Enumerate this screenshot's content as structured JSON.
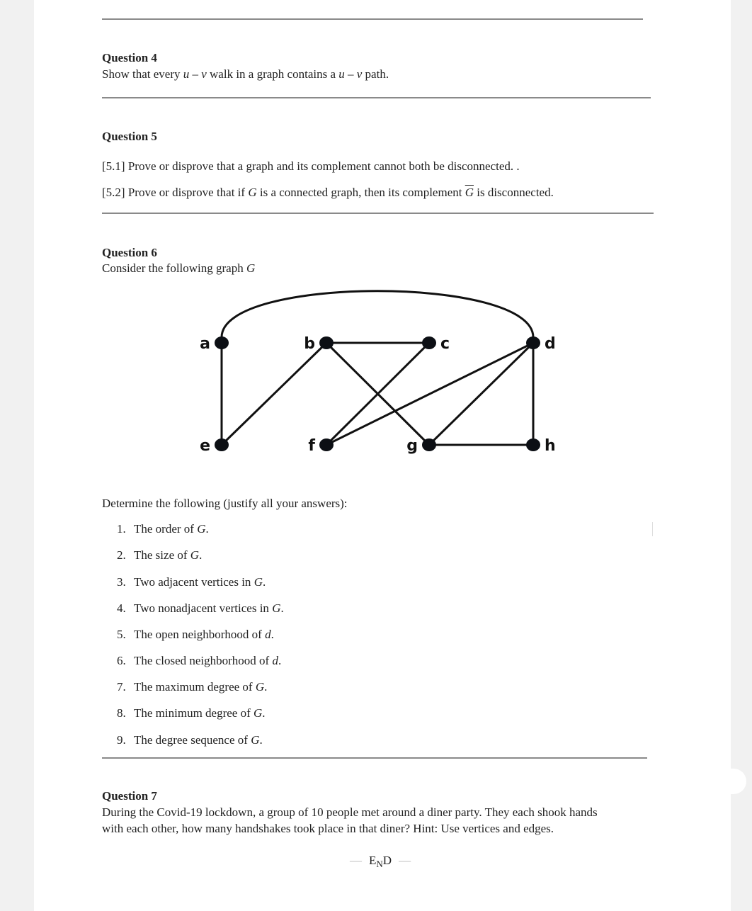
{
  "q4": {
    "title": "Question 4",
    "body_pre": "Show that every ",
    "u1": "u",
    "dash1": " – ",
    "v1": "v",
    "body_mid": " walk in a graph contains a ",
    "u2": "u",
    "dash2": " – ",
    "v2": "v",
    "body_post": " path."
  },
  "q5": {
    "title": "Question 5",
    "part1": "[5.1]  Prove or disprove that a graph and its complement cannot both be disconnected.  .",
    "part2_pre": "[5.2]  Prove or disprove that if ",
    "part2_G": "G",
    "part2_mid": " is a connected graph, then its complement ",
    "part2_Gbar": "G",
    "part2_post": " is disconnected."
  },
  "q6": {
    "title": "Question 6",
    "intro_pre": "Consider the following graph ",
    "intro_G": "G",
    "graph": {
      "vertices": [
        {
          "id": "a",
          "col": 0,
          "row": 0,
          "label_side": "left"
        },
        {
          "id": "b",
          "col": 1,
          "row": 0,
          "label_side": "left"
        },
        {
          "id": "c",
          "col": 2,
          "row": 0,
          "label_side": "right"
        },
        {
          "id": "d",
          "col": 3,
          "row": 0,
          "label_side": "right"
        },
        {
          "id": "e",
          "col": 0,
          "row": 1,
          "label_side": "left"
        },
        {
          "id": "f",
          "col": 1,
          "row": 1,
          "label_side": "left"
        },
        {
          "id": "g",
          "col": 2,
          "row": 1,
          "label_side": "left"
        },
        {
          "id": "h",
          "col": 3,
          "row": 1,
          "label_side": "right"
        }
      ],
      "edges": [
        {
          "from": "a",
          "to": "d",
          "curved": true
        },
        {
          "from": "a",
          "to": "e"
        },
        {
          "from": "b",
          "to": "c"
        },
        {
          "from": "b",
          "to": "e"
        },
        {
          "from": "b",
          "to": "g"
        },
        {
          "from": "c",
          "to": "f"
        },
        {
          "from": "d",
          "to": "f"
        },
        {
          "from": "d",
          "to": "g"
        },
        {
          "from": "d",
          "to": "h"
        },
        {
          "from": "g",
          "to": "h"
        }
      ]
    },
    "determine": "Determine the following (justify all your answers):",
    "items": [
      {
        "num": "1.",
        "pre": "The order of ",
        "var": "G",
        "post": "."
      },
      {
        "num": "2.",
        "pre": "The size of ",
        "var": "G",
        "post": "."
      },
      {
        "num": "3.",
        "pre": "Two adjacent vertices in ",
        "var": "G",
        "post": "."
      },
      {
        "num": "4.",
        "pre": "Two nonadjacent vertices in ",
        "var": "G",
        "post": "."
      },
      {
        "num": "5.",
        "pre": "The open neighborhood of ",
        "var": "d",
        "post": "."
      },
      {
        "num": "6.",
        "pre": "The closed neighborhood of ",
        "var": "d",
        "post": "."
      },
      {
        "num": "7.",
        "pre": "The maximum degree of ",
        "var": "G",
        "post": "."
      },
      {
        "num": "8.",
        "pre": "The minimum degree of ",
        "var": "G",
        "post": "."
      },
      {
        "num": "9.",
        "pre": "The degree sequence of ",
        "var": "G",
        "post": "."
      }
    ]
  },
  "q7": {
    "title": "Question 7",
    "line1": "During the Covid-19 lockdown, a group of 10 people met around a diner party.  They each shook hands",
    "line2": "with each other, how many handshakes took place in that diner? Hint:  Use vertices and edges."
  },
  "footer": {
    "dash": "—",
    "end_e": "E",
    "end_n": "N",
    "end_d": "D"
  }
}
